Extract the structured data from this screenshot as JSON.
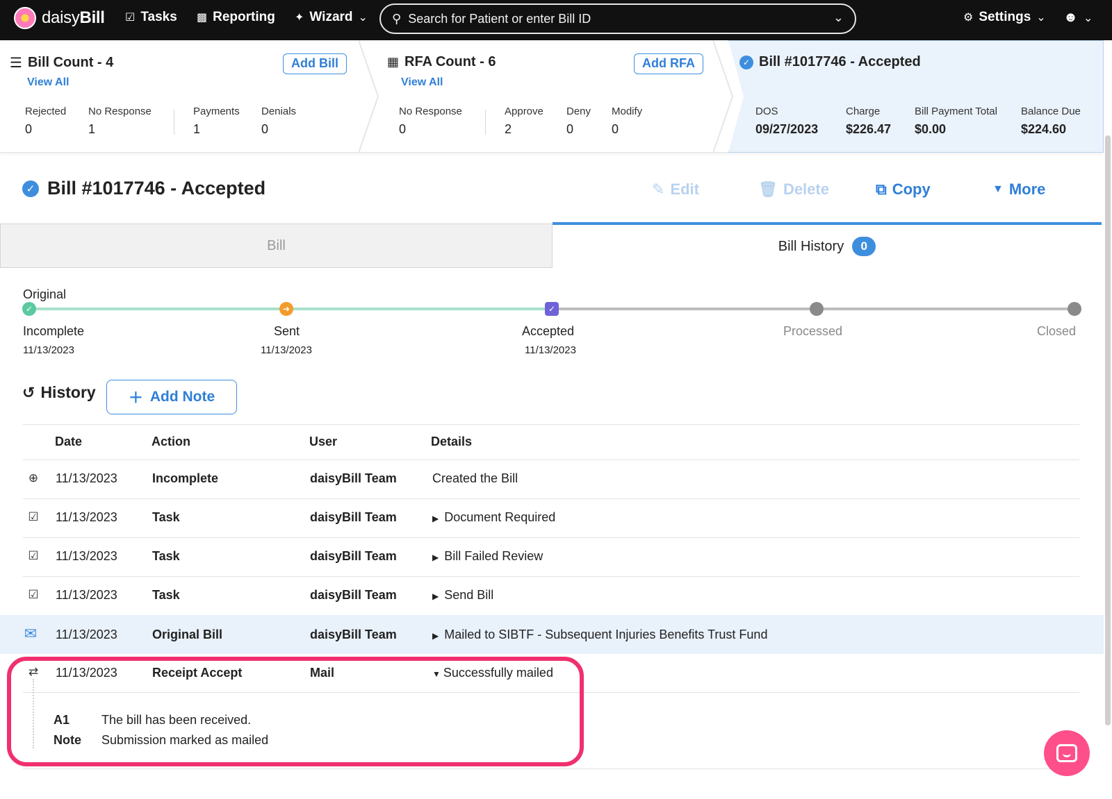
{
  "nav": {
    "logo_prefix": "daisy",
    "logo_suffix": "Bill",
    "tasks": "Tasks",
    "reporting": "Reporting",
    "wizard": "Wizard",
    "search_placeholder": "Search for Patient or enter Bill ID",
    "settings": "Settings"
  },
  "summary": {
    "bills": {
      "title": "Bill Count - 4",
      "view_all": "View All",
      "add_button": "Add Bill",
      "stats": [
        {
          "label": "Rejected",
          "value": "0"
        },
        {
          "label": "No Response",
          "value": "1"
        },
        {
          "label": "Payments",
          "value": "1"
        },
        {
          "label": "Denials",
          "value": "0"
        }
      ]
    },
    "rfas": {
      "title": "RFA Count - 6",
      "view_all": "View All",
      "add_button": "Add RFA",
      "stats": [
        {
          "label": "No Response",
          "value": "0"
        },
        {
          "label": "Approve",
          "value": "2"
        },
        {
          "label": "Deny",
          "value": "0"
        },
        {
          "label": "Modify",
          "value": "0"
        }
      ]
    },
    "current": {
      "title": "Bill #1017746 - Accepted",
      "stats": [
        {
          "label": "DOS",
          "value": "09/27/2023"
        },
        {
          "label": "Charge",
          "value": "$226.47"
        },
        {
          "label": "Bill Payment Total",
          "value": "$0.00"
        },
        {
          "label": "Balance Due",
          "value": "$224.60"
        }
      ]
    }
  },
  "bill": {
    "title": "Bill #1017746 - Accepted",
    "actions": {
      "edit": "Edit",
      "delete": "Delete",
      "copy": "Copy",
      "more": "More"
    }
  },
  "tabs": {
    "bill": "Bill",
    "history": "Bill History",
    "history_badge": "0"
  },
  "timeline": {
    "version_label": "Original",
    "steps": [
      {
        "label": "Incomplete",
        "date": "11/13/2023",
        "state": "done"
      },
      {
        "label": "Sent",
        "date": "11/13/2023",
        "state": "done"
      },
      {
        "label": "Accepted",
        "date": "11/13/2023",
        "state": "current"
      },
      {
        "label": "Processed",
        "date": "",
        "state": "pending"
      },
      {
        "label": "Closed",
        "date": "",
        "state": "pending"
      }
    ],
    "colors": {
      "done": "#5cc9a0",
      "sent": "#f39b2b",
      "current": "#6f62d8",
      "pending": "#9e9e9e"
    }
  },
  "history": {
    "title": "History",
    "add_note": "Add Note",
    "columns": [
      "Date",
      "Action",
      "User",
      "Details"
    ],
    "rows": [
      {
        "icon": "plus-circle-icon",
        "date": "11/13/2023",
        "action": "Incomplete",
        "user": "daisyBill Team",
        "details": "Created the Bill"
      },
      {
        "icon": "task-icon",
        "date": "11/13/2023",
        "action": "Task",
        "user": "daisyBill Team",
        "details": "Document Required"
      },
      {
        "icon": "task-icon",
        "date": "11/13/2023",
        "action": "Task",
        "user": "daisyBill Team",
        "details": "Bill Failed Review"
      },
      {
        "icon": "task-icon",
        "date": "11/13/2023",
        "action": "Task",
        "user": "daisyBill Team",
        "details": "Send Bill"
      },
      {
        "icon": "envelope-icon",
        "date": "11/13/2023",
        "action": "Original Bill",
        "user": "daisyBill Team",
        "details": "Mailed to SIBTF - Subsequent Injuries Benefits Trust Fund"
      },
      {
        "icon": "exchange-icon",
        "date": "11/13/2023",
        "action": "Receipt Accept",
        "user": "Mail",
        "details": "Successfully mailed"
      }
    ],
    "expanded": [
      {
        "key": "A1",
        "value": "The bill has been received."
      },
      {
        "key": "Note",
        "value": "Submission marked as mailed"
      }
    ]
  },
  "colors": {
    "accent": "#3e8ede",
    "highlight": "#f0306e",
    "chat": "#ff4f8b"
  }
}
